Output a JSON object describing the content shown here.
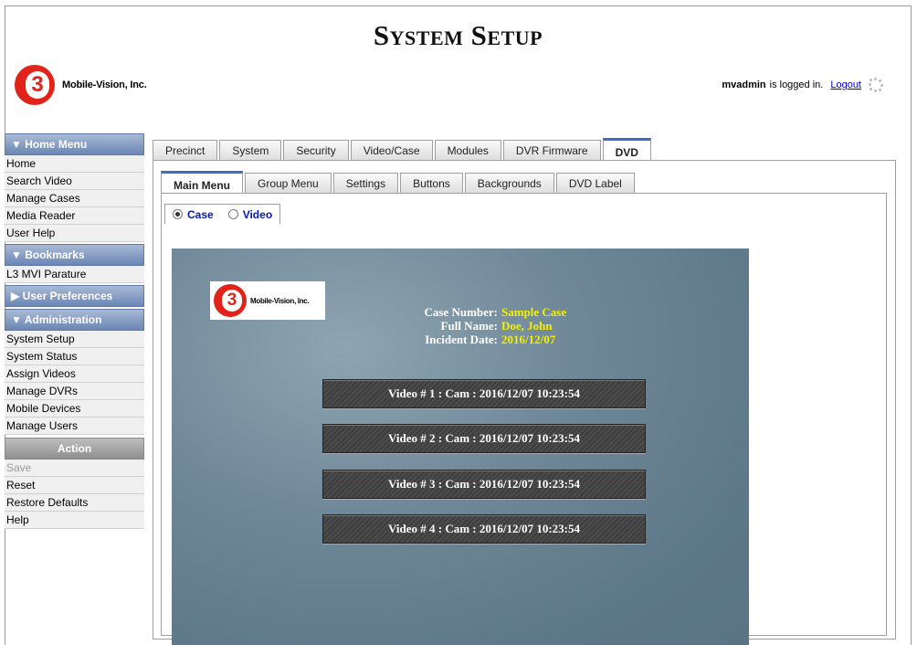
{
  "header": {
    "title": "System Setup",
    "company": "Mobile-Vision, Inc.",
    "logo_text": "3",
    "user": "mvadmin",
    "logged_in_text": "is logged in.",
    "logout": "Logout"
  },
  "sidebar": {
    "home_menu": {
      "title": "▼ Home Menu",
      "items": [
        "Home",
        "Search Video",
        "Manage Cases",
        "Media Reader",
        "User Help"
      ]
    },
    "bookmarks": {
      "title": "▼ Bookmarks",
      "items": [
        "L3 MVI Parature"
      ]
    },
    "user_preferences": {
      "title": "▶ User Preferences"
    },
    "administration": {
      "title": "▼ Administration",
      "items": [
        "System Setup",
        "System Status",
        "Assign Videos",
        "Manage DVRs",
        "Mobile Devices",
        "Manage Users"
      ]
    },
    "action": {
      "title": "Action",
      "items": [
        {
          "label": "Save",
          "disabled": true
        },
        {
          "label": "Reset",
          "disabled": false
        },
        {
          "label": "Restore Defaults",
          "disabled": false
        },
        {
          "label": "Help",
          "disabled": false
        }
      ]
    }
  },
  "tabs": [
    "Precinct",
    "System",
    "Security",
    "Video/Case",
    "Modules",
    "DVR Firmware",
    "DVD"
  ],
  "active_tab": "DVD",
  "subtabs": [
    "Main Menu",
    "Group Menu",
    "Settings",
    "Buttons",
    "Backgrounds",
    "DVD Label"
  ],
  "active_subtab": "Main Menu",
  "radios": [
    {
      "label": "Case",
      "checked": true
    },
    {
      "label": "Video",
      "checked": false
    }
  ],
  "preview": {
    "logo_company": "Mobile-Vision, Inc.",
    "case_info": [
      {
        "label": "Case Number:",
        "value": "Sample Case"
      },
      {
        "label": "Full Name:",
        "value": "Doe, John"
      },
      {
        "label": "Incident Date:",
        "value": "2016/12/07"
      }
    ],
    "video_buttons": [
      "Video # 1 : Cam : 2016/12/07 10:23:54",
      "Video # 2 : Cam : 2016/12/07 10:23:54",
      "Video # 3 : Cam : 2016/12/07 10:23:54",
      "Video # 4 : Cam : 2016/12/07 10:23:54"
    ]
  },
  "colors": {
    "menu_header": "#6a86b4",
    "active_tab_accent": "#3b6cc7",
    "radio_label": "#0018b8",
    "case_value": "#f6f000",
    "logo_red": "#e2231a"
  }
}
